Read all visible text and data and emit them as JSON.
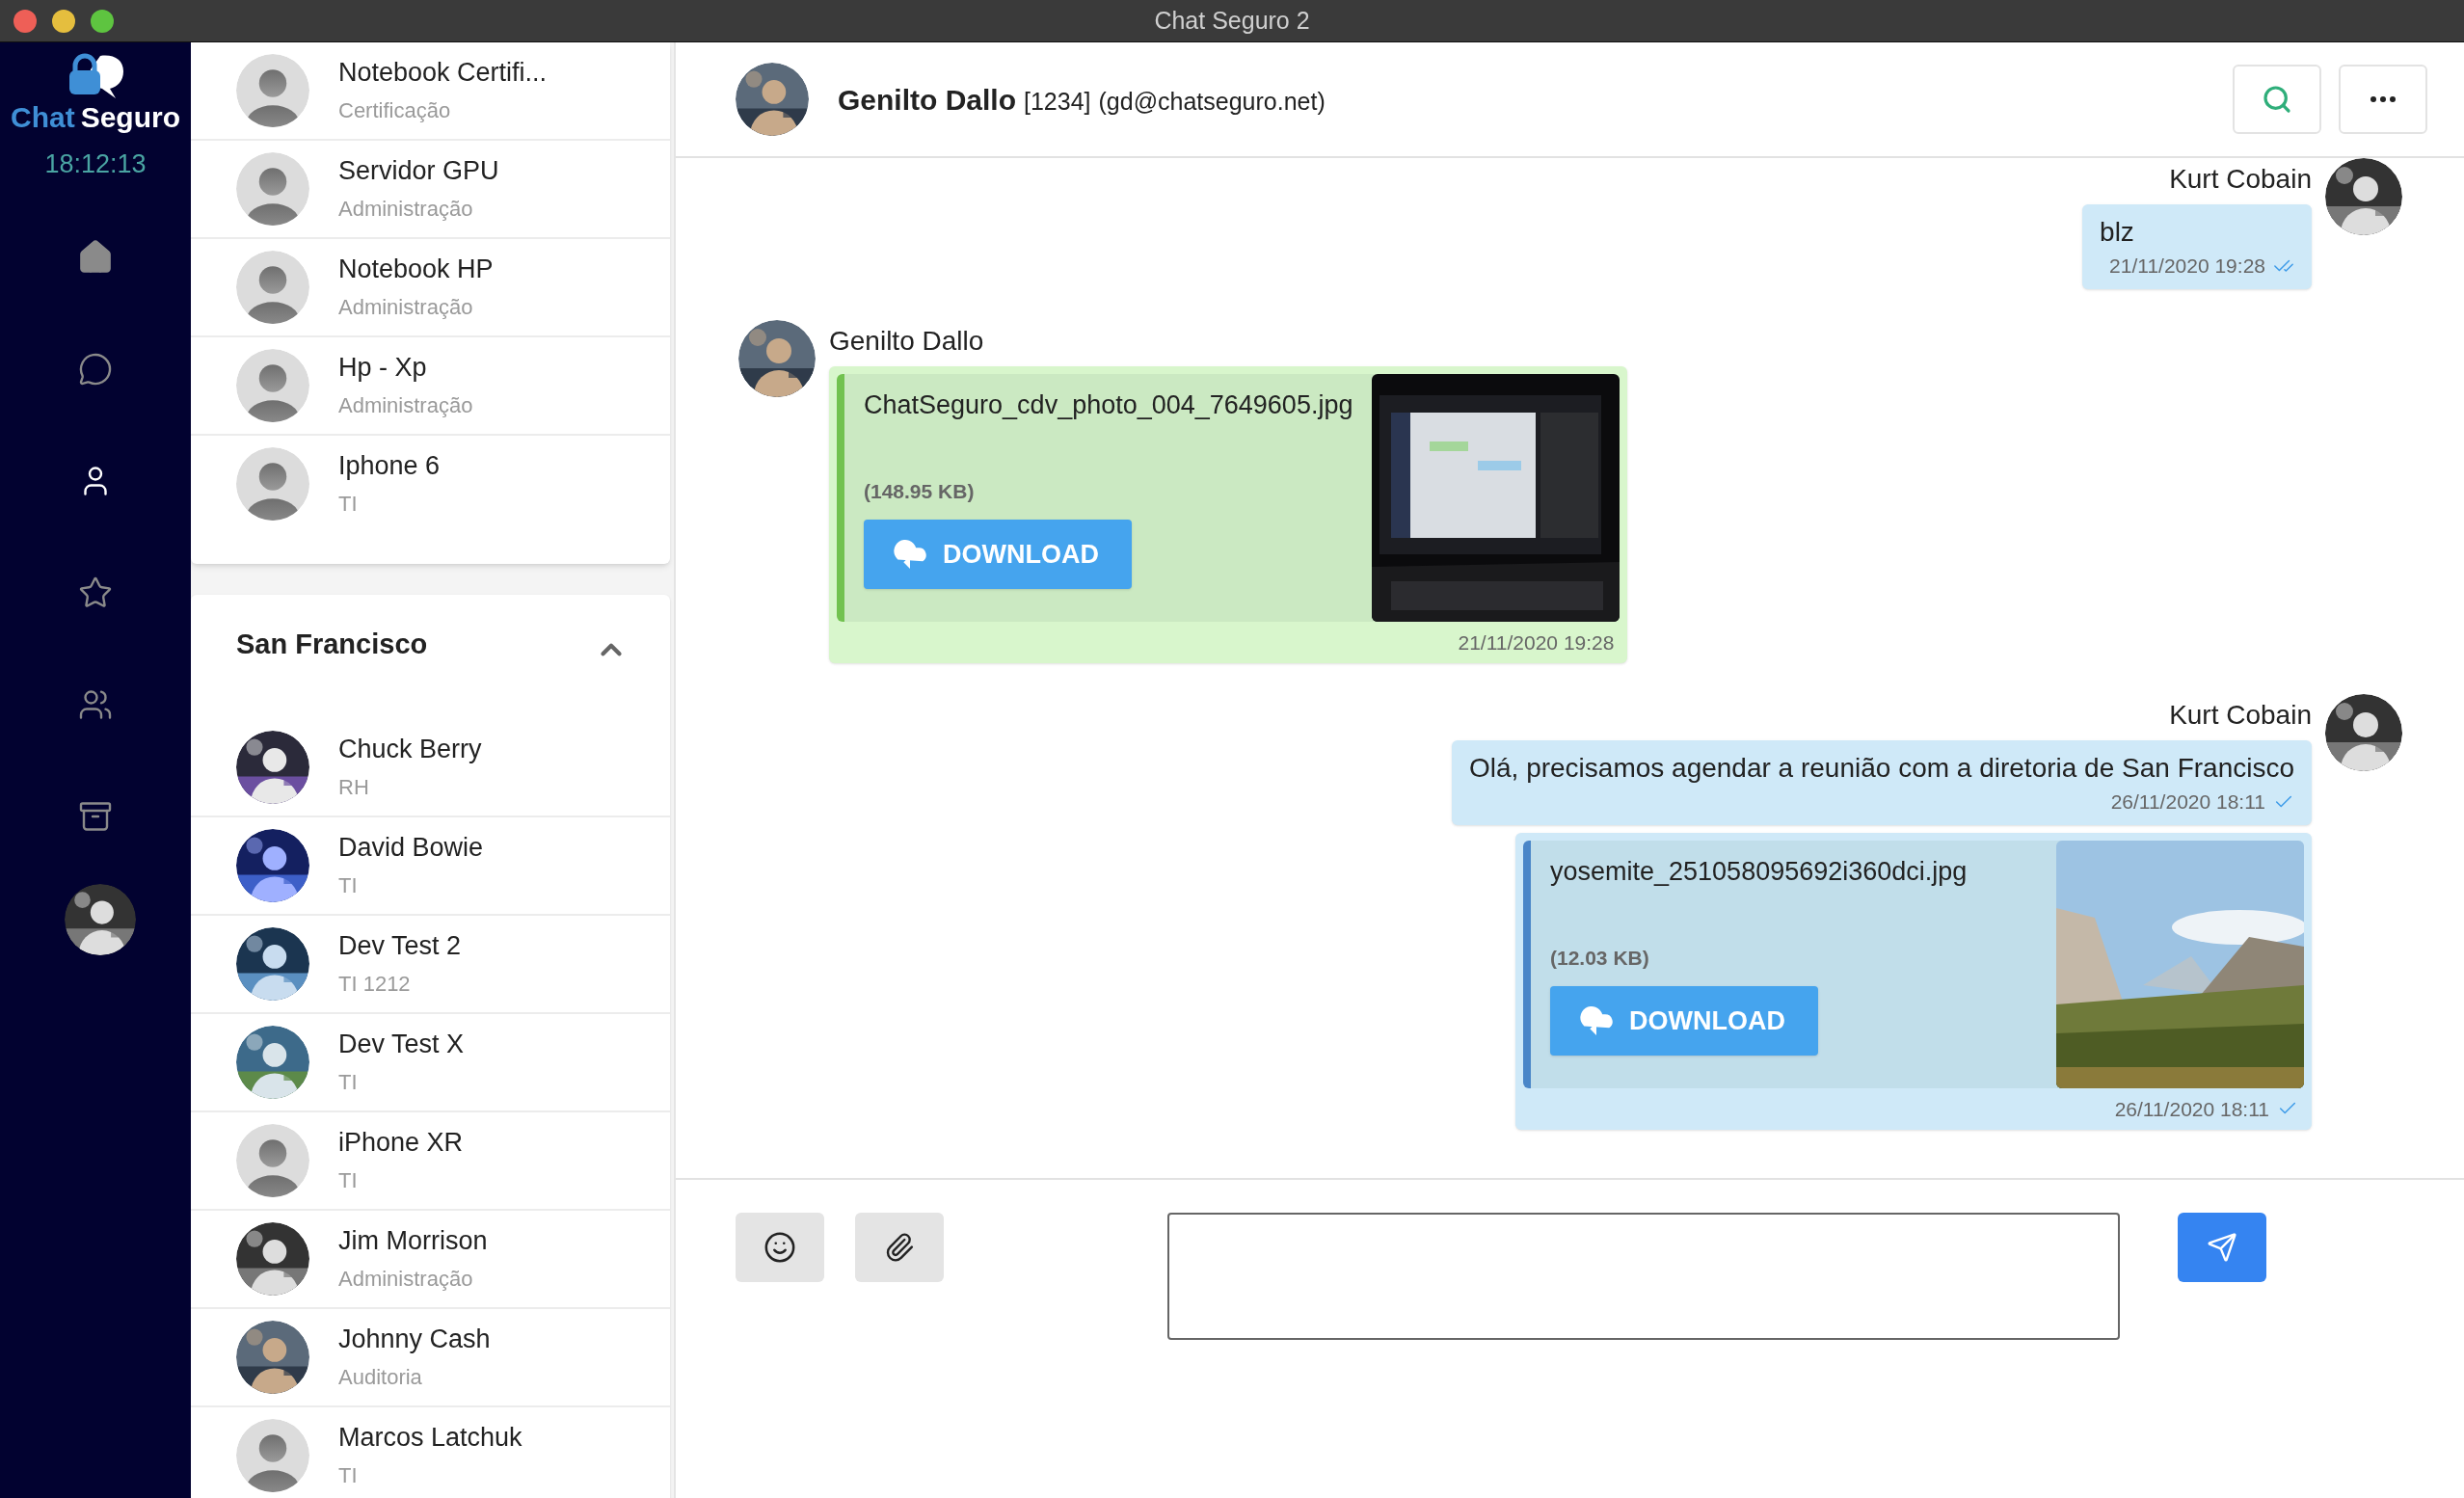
{
  "window": {
    "title": "Chat Seguro 2"
  },
  "sidebar": {
    "logo": {
      "part_1": "Chat",
      "part_2": "Seguro"
    },
    "clock": "18:12:13",
    "nav": [
      {
        "kind": "home",
        "selected": false
      },
      {
        "kind": "chats",
        "selected": false
      },
      {
        "kind": "contacts",
        "selected": true
      },
      {
        "kind": "favorites",
        "selected": false
      },
      {
        "kind": "groups",
        "selected": false
      },
      {
        "kind": "archive",
        "selected": false
      }
    ]
  },
  "contacts": {
    "top_group": {
      "items": [
        {
          "name": "Notebook Certifi...",
          "department": "Certificação",
          "has_photo": false
        },
        {
          "name": "Servidor GPU",
          "department": "Administração",
          "has_photo": false
        },
        {
          "name": "Notebook HP",
          "department": "Administração",
          "has_photo": false
        },
        {
          "name": "Hp - Xp",
          "department": "Administração",
          "has_photo": false
        },
        {
          "name": "Iphone 6",
          "department": "TI",
          "has_photo": false
        }
      ]
    },
    "group": {
      "title": "San Francisco",
      "expanded": true,
      "items": [
        {
          "name": "Chuck Berry",
          "department": "RH",
          "has_photo": true
        },
        {
          "name": "David Bowie",
          "department": "TI",
          "has_photo": true
        },
        {
          "name": "Dev Test 2",
          "department": "TI 1212",
          "has_photo": true
        },
        {
          "name": "Dev Test X",
          "department": "TI",
          "has_photo": true
        },
        {
          "name": "iPhone XR",
          "department": "TI",
          "has_photo": false
        },
        {
          "name": "Jim Morrison",
          "department": "Administração",
          "has_photo": true
        },
        {
          "name": "Johnny Cash",
          "department": "Auditoria",
          "has_photo": true
        },
        {
          "name": "Marcos Latchuk",
          "department": "TI",
          "has_photo": false
        }
      ]
    }
  },
  "conversation": {
    "contact": {
      "name": "Genilto Dallo",
      "code": "[1234]",
      "email": "(gd@chatseguro.net)"
    },
    "messages": [
      {
        "outgoing": true,
        "sender": "Kurt Cobain",
        "parts": [
          {
            "kind": "text",
            "text": "blz",
            "time": "21/11/2020 19:28",
            "sent": true,
            "read": true
          }
        ]
      },
      {
        "outgoing": false,
        "sender": "Genilto Dallo",
        "parts": [
          {
            "kind": "file",
            "file_name": "ChatSeguro_cdv_photo_004_7649605.jpg",
            "size": "(148.95 KB)",
            "button": "DOWNLOAD",
            "time": "21/11/2020 19:28",
            "sent": false
          }
        ]
      },
      {
        "outgoing": true,
        "sender": "Kurt Cobain",
        "parts": [
          {
            "kind": "text",
            "text": "Olá, precisamos agendar a reunião com a diretoria de San Francisco",
            "time": "26/11/2020 18:11",
            "sent": true,
            "read": false
          },
          {
            "kind": "file",
            "file_name": "yosemite_251058095692i360dci.jpg",
            "size": "(12.03 KB)",
            "button": "DOWNLOAD",
            "time": "26/11/2020 18:11",
            "sent": true,
            "read": false
          }
        ]
      }
    ]
  }
}
